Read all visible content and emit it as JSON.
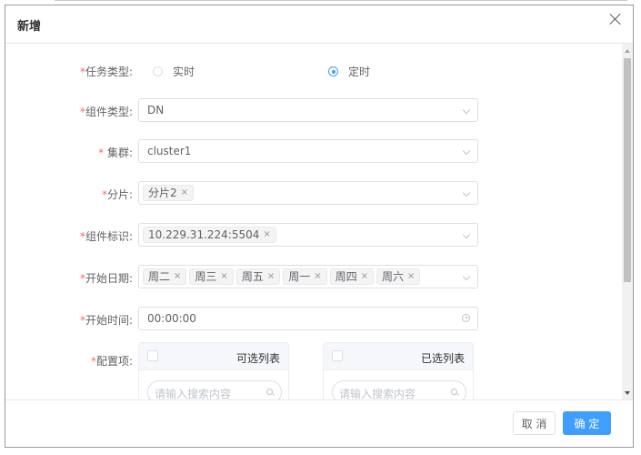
{
  "dialog": {
    "title": "新增"
  },
  "form": {
    "task_type": {
      "label": "任务类型:",
      "options": [
        "实时",
        "定时"
      ],
      "selected": "定时"
    },
    "component_type": {
      "label": "组件类型:",
      "value": "DN"
    },
    "cluster": {
      "label": " 集群:",
      "value": "cluster1"
    },
    "shard": {
      "label": "分片:",
      "tags": [
        "分片2"
      ]
    },
    "component_id": {
      "label": "组件标识:",
      "tags": [
        "10.229.31.224:5504"
      ]
    },
    "start_date": {
      "label": "开始日期:",
      "tags": [
        "周二",
        "周三",
        "周五",
        "周一",
        "周四",
        "周六"
      ]
    },
    "start_time": {
      "label": "开始时间:",
      "value": "00:00:00"
    },
    "config": {
      "label": "配置项:",
      "available": {
        "title": "可选列表",
        "placeholder": "请输入搜索内容"
      },
      "selected": {
        "title": "已选列表",
        "placeholder": "请输入搜索内容"
      }
    }
  },
  "footer": {
    "cancel_label": "取 消",
    "ok_label": "确 定"
  },
  "colors": {
    "primary": "#409eff",
    "required": "#f56c6c"
  }
}
